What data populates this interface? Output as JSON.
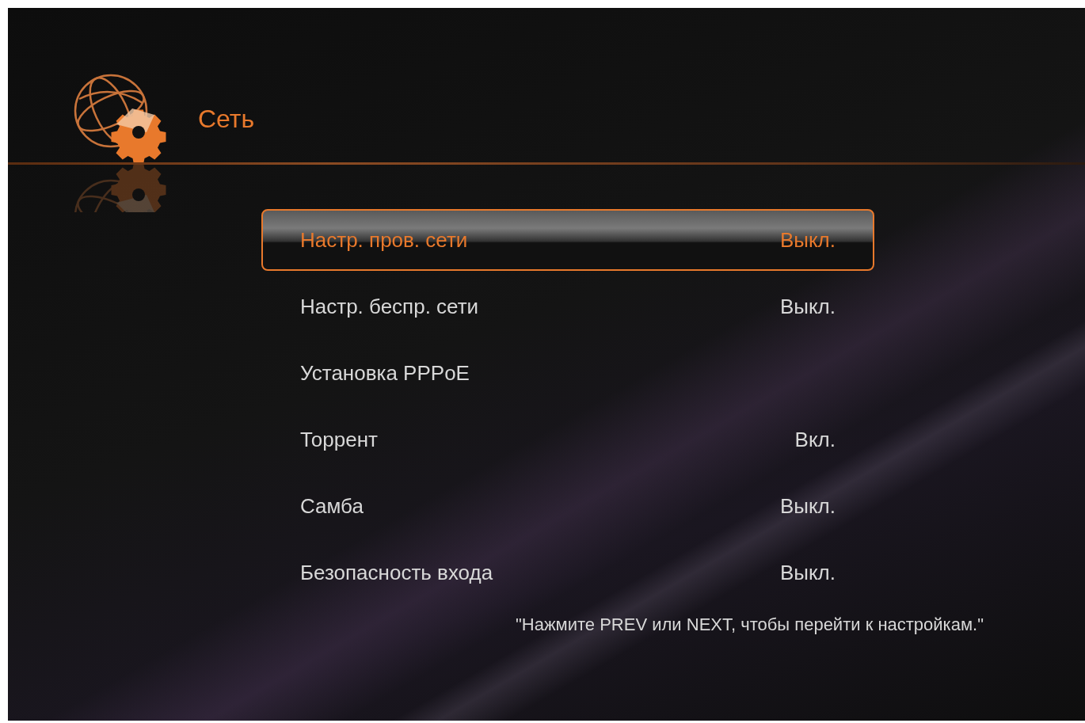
{
  "header": {
    "title": "Сеть"
  },
  "menu": [
    {
      "label": "Настр. пров. сети",
      "value": "Выкл.",
      "selected": true
    },
    {
      "label": "Настр. беспр. сети",
      "value": "Выкл.",
      "selected": false
    },
    {
      "label": "Установка PPPoE",
      "selected": false
    },
    {
      "label": "Торрент",
      "value": "Вкл.",
      "selected": false
    },
    {
      "label": "Самба",
      "value": "Выкл.",
      "selected": false
    },
    {
      "label": "Безопасность входа",
      "value": "Выкл.",
      "selected": false
    }
  ],
  "hint": "\"Нажмите PREV или NEXT, чтобы перейти к настройкам.\""
}
